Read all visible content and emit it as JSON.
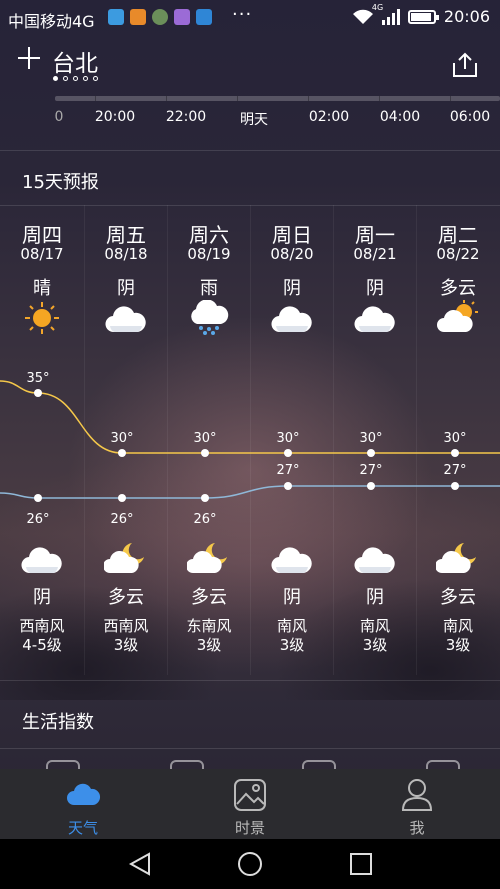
{
  "status_bar": {
    "carrier": "中国移动4G",
    "network_badge": "4G",
    "time": "20:06",
    "more": "···"
  },
  "header": {
    "city": "台北",
    "page_count": 5,
    "current_page": 0
  },
  "hourly": {
    "labels": [
      "0",
      "20:00",
      "22:00",
      "明天",
      "02:00",
      "04:00",
      "06:00"
    ]
  },
  "forecast": {
    "title": "15天预报",
    "days": [
      {
        "dow": "周四",
        "date": "08/17",
        "day_cond": "晴",
        "day_icon": "sun-icon",
        "high": "35°",
        "low": "26°",
        "night_icon": "cloud-icon",
        "night_cond": "阴",
        "wind_dir": "西南风",
        "wind_level": "4-5级"
      },
      {
        "dow": "周五",
        "date": "08/18",
        "day_cond": "阴",
        "day_icon": "cloud-icon",
        "high": "30°",
        "low": "26°",
        "night_icon": "moon-cloud-icon",
        "night_cond": "多云",
        "wind_dir": "西南风",
        "wind_level": "3级"
      },
      {
        "dow": "周六",
        "date": "08/19",
        "day_cond": "雨",
        "day_icon": "rain-icon",
        "high": "30°",
        "low": "26°",
        "night_icon": "moon-cloud-icon",
        "night_cond": "多云",
        "wind_dir": "东南风",
        "wind_level": "3级"
      },
      {
        "dow": "周日",
        "date": "08/20",
        "day_cond": "阴",
        "day_icon": "cloud-icon",
        "high": "30°",
        "low": "27°",
        "night_icon": "cloud-icon",
        "night_cond": "阴",
        "wind_dir": "南风",
        "wind_level": "3级"
      },
      {
        "dow": "周一",
        "date": "08/21",
        "day_cond": "阴",
        "day_icon": "cloud-icon",
        "high": "30°",
        "low": "27°",
        "night_icon": "cloud-icon",
        "night_cond": "阴",
        "wind_dir": "南风",
        "wind_level": "3级"
      },
      {
        "dow": "周二",
        "date": "08/22",
        "day_cond": "多云",
        "day_icon": "sun-cloud-icon",
        "high": "30°",
        "low": "27°",
        "night_icon": "moon-cloud-icon",
        "night_cond": "多云",
        "wind_dir": "南风",
        "wind_level": "3级"
      }
    ],
    "high_values": [
      35,
      30,
      30,
      30,
      30,
      30
    ],
    "low_values": [
      26,
      26,
      26,
      27,
      27,
      27
    ],
    "high_color": "#f5c84a",
    "low_color": "#8fb8d8"
  },
  "life_index": {
    "title": "生活指数"
  },
  "bottom_nav": {
    "tabs": [
      {
        "label": "天气",
        "icon": "cloud-icon",
        "active": true
      },
      {
        "label": "时景",
        "icon": "photo-icon",
        "active": false
      },
      {
        "label": "我",
        "icon": "person-icon",
        "active": false
      }
    ],
    "accent": "#3d8fe9"
  }
}
